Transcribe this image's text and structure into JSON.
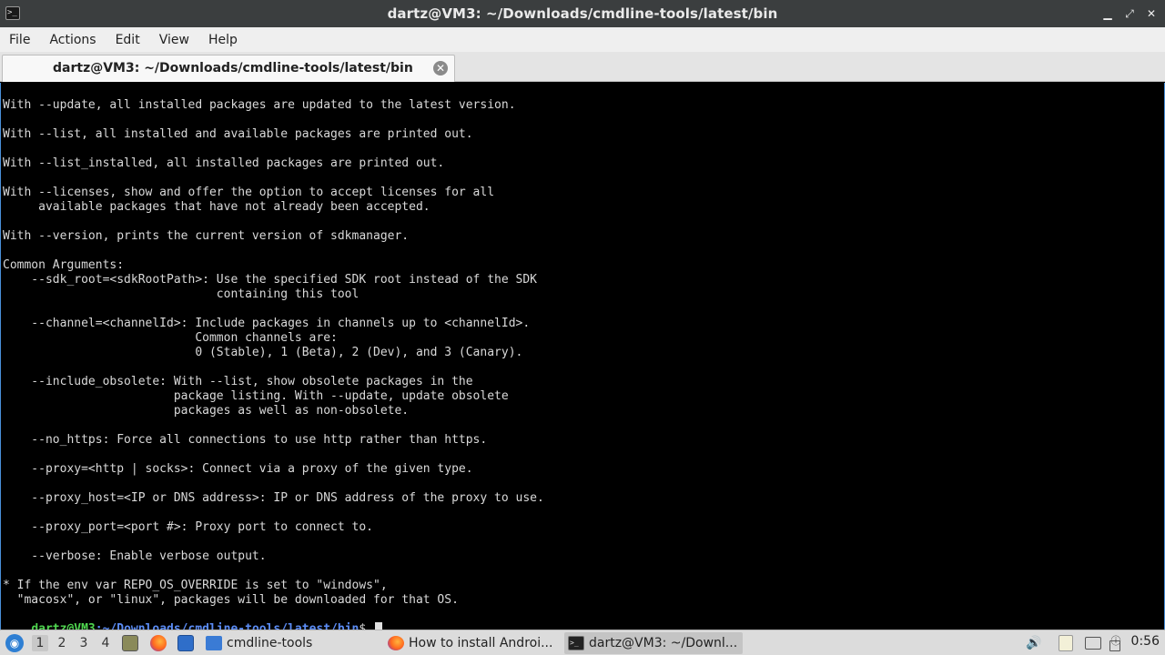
{
  "window": {
    "title": "dartz@VM3: ~/Downloads/cmdline-tools/latest/bin",
    "app_icon": "terminal-icon",
    "controls": {
      "minimize": "▁",
      "maximize": "⤢",
      "close": "✕"
    }
  },
  "menubar": {
    "items": [
      "File",
      "Actions",
      "Edit",
      "View",
      "Help"
    ]
  },
  "tab": {
    "label": "dartz@VM3: ~/Downloads/cmdline-tools/latest/bin",
    "close": "✕"
  },
  "terminal": {
    "lines": [
      "With --update, all installed packages are updated to the latest version.",
      "",
      "With --list, all installed and available packages are printed out.",
      "",
      "With --list_installed, all installed packages are printed out.",
      "",
      "With --licenses, show and offer the option to accept licenses for all",
      "     available packages that have not already been accepted.",
      "",
      "With --version, prints the current version of sdkmanager.",
      "",
      "Common Arguments:",
      "    --sdk_root=<sdkRootPath>: Use the specified SDK root instead of the SDK",
      "                              containing this tool",
      "",
      "    --channel=<channelId>: Include packages in channels up to <channelId>.",
      "                           Common channels are:",
      "                           0 (Stable), 1 (Beta), 2 (Dev), and 3 (Canary).",
      "",
      "    --include_obsolete: With --list, show obsolete packages in the",
      "                        package listing. With --update, update obsolete",
      "                        packages as well as non-obsolete.",
      "",
      "    --no_https: Force all connections to use http rather than https.",
      "",
      "    --proxy=<http | socks>: Connect via a proxy of the given type.",
      "",
      "    --proxy_host=<IP or DNS address>: IP or DNS address of the proxy to use.",
      "",
      "    --proxy_port=<port #>: Proxy port to connect to.",
      "",
      "    --verbose: Enable verbose output.",
      "",
      "* If the env var REPO_OS_OVERRIDE is set to \"windows\",",
      "  \"macosx\", or \"linux\", packages will be downloaded for that OS."
    ],
    "prompt": {
      "user_host": "dartz@VM3",
      "path": ":~/Downloads/cmdline-tools/latest/bin",
      "symbol": "$ "
    }
  },
  "taskbar": {
    "start_icon": "start-menu-icon",
    "workspaces": [
      "1",
      "2",
      "3",
      "4"
    ],
    "active_workspace": "1",
    "tasks": [
      {
        "label": "cmdline-tools",
        "icon": "folder-icon"
      },
      {
        "label": "How to install Androi...",
        "icon": "firefox-icon"
      },
      {
        "label": "dartz@VM3: ~/Downl...",
        "icon": "terminal-icon"
      }
    ],
    "tray": [
      "volume-icon",
      "clipboard-icon",
      "display-icon",
      "update-icon",
      "power-icon"
    ],
    "clock": "0:56"
  }
}
